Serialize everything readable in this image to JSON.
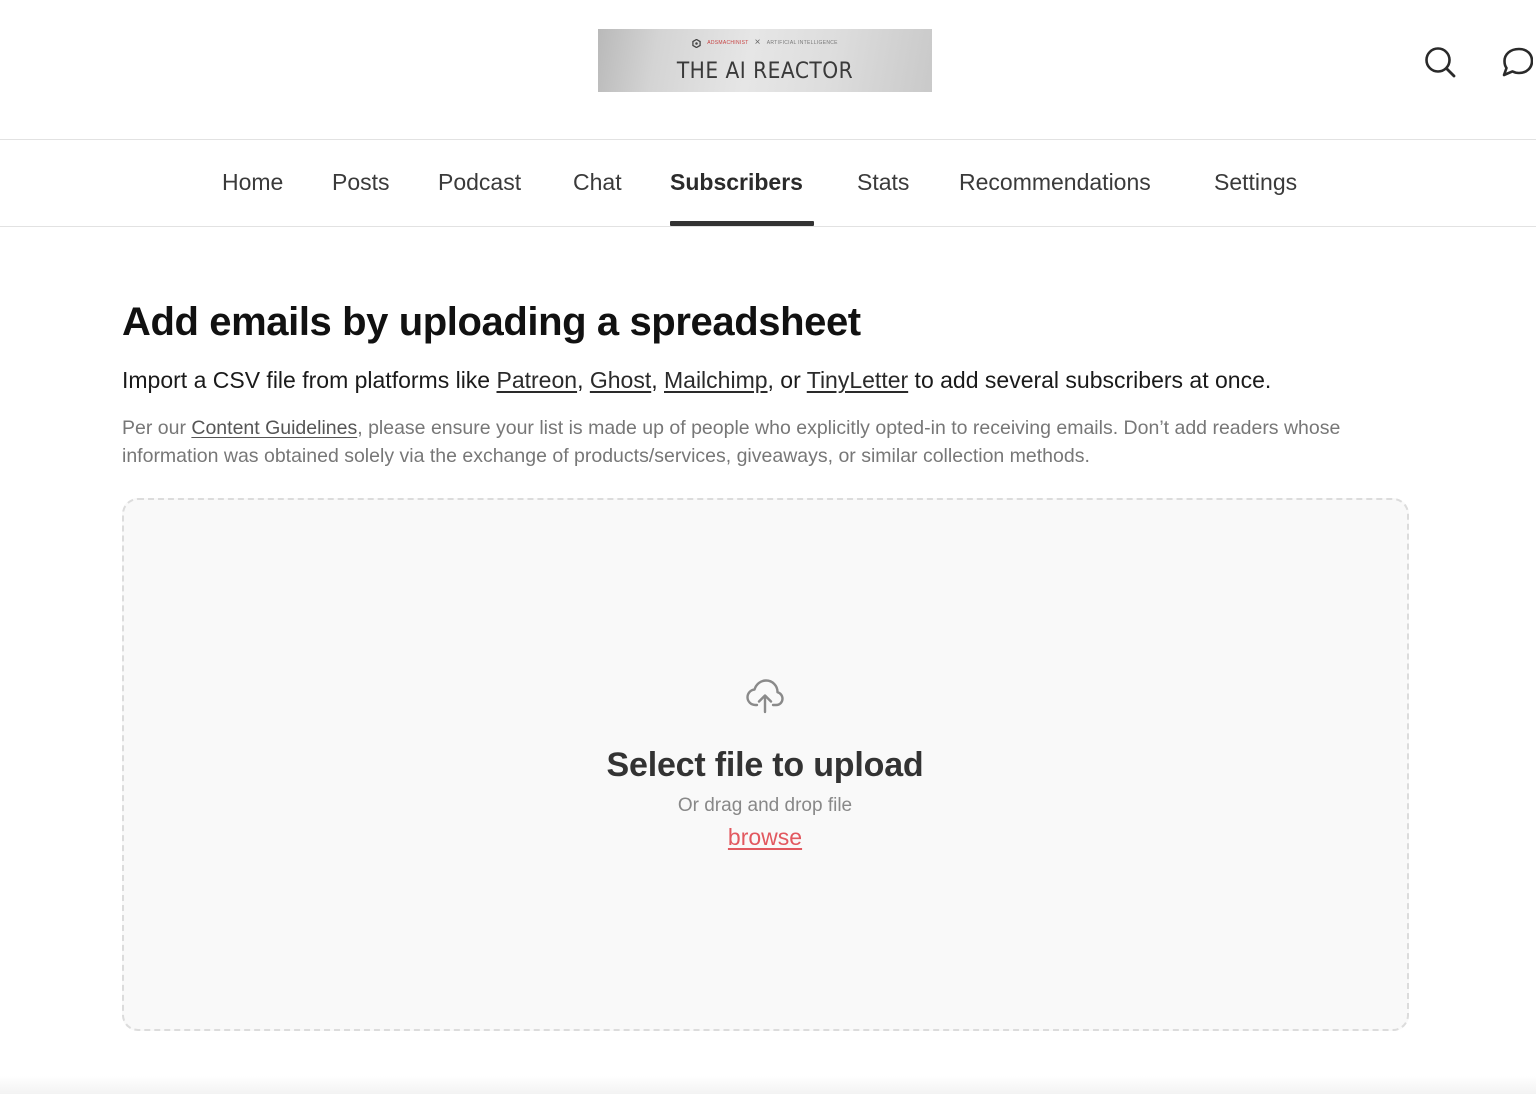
{
  "header": {
    "logo": {
      "brand_left": "ADSMACHINIST",
      "separator": "×",
      "brand_right": "ARTIFICIAL INTELLIGENCE",
      "title": "THE AI REACTOR"
    },
    "icons": [
      "search-icon",
      "chat-bubble-icon"
    ]
  },
  "nav": {
    "items": [
      {
        "label": "Home"
      },
      {
        "label": "Posts"
      },
      {
        "label": "Podcast"
      },
      {
        "label": "Chat"
      },
      {
        "label": "Subscribers"
      },
      {
        "label": "Stats"
      },
      {
        "label": "Recommendations"
      },
      {
        "label": "Settings"
      }
    ],
    "active": "Subscribers"
  },
  "main": {
    "heading": "Add emails by uploading a spreadsheet",
    "intro": {
      "prefix": "Import a CSV file from platforms like ",
      "links": [
        "Patreon",
        "Ghost",
        "Mailchimp",
        "TinyLetter"
      ],
      "sep1": ", ",
      "sep2": ", ",
      "sep3": ", or ",
      "suffix": " to add several subscribers at once."
    },
    "guidelines": {
      "prefix": "Per our ",
      "link": "Content Guidelines",
      "suffix": ", please ensure your list is made up of people who explicitly opted-in to receiving emails. Don’t add readers whose information was obtained solely via the exchange of products/services, giveaways, or similar collection methods."
    },
    "upload": {
      "icon": "cloud-upload-icon",
      "title": "Select file to upload",
      "subtitle": "Or drag and drop file",
      "browse_label": "browse"
    }
  },
  "colors": {
    "accent": "#e2585f",
    "dropzone_bg": "#f9f9f9",
    "dropzone_border": "#dcdcdc",
    "nav_underline": "#333333"
  }
}
